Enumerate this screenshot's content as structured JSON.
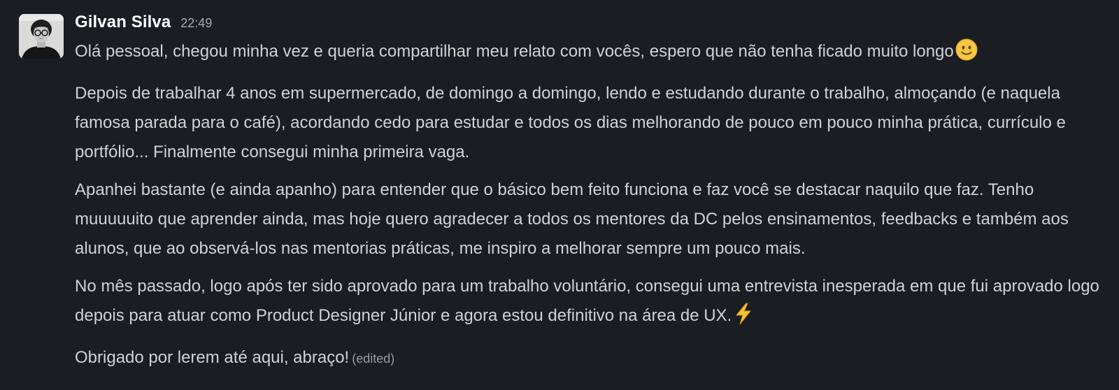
{
  "message": {
    "author": "Gilvan Silva",
    "timestamp": "22:49",
    "paragraphs": [
      "Olá pessoal, chegou minha vez e queria compartilhar meu relato com vocês, espero que não tenha ficado muito longo",
      "Depois de trabalhar 4 anos em supermercado, de domingo a domingo, lendo e estudando durante o trabalho, almoçando (e naquela famosa parada para o café), acordando cedo para estudar e todos os dias melhorando de pouco em pouco minha prática, currículo e portfólio... Finalmente consegui minha primeira vaga.",
      "Apanhei bastante (e ainda apanho) para entender que o básico bem feito funciona e faz você se destacar naquilo que faz. Tenho muuuuuito que aprender ainda, mas hoje quero agradecer a todos os mentores da DC pelos ensinamentos, feedbacks e também aos alunos, que ao observá-los nas mentorias práticas, me inspiro a melhorar sempre um pouco mais.",
      "No mês passado, logo após ter sido aprovado para um trabalho voluntário, consegui uma entrevista inesperada em que fui aprovado logo depois para atuar como Product Designer Júnior e agora estou definitivo na área de UX.",
      "Obrigado por lerem até aqui, abraço!"
    ],
    "edited_label": "(edited)",
    "emojis": {
      "first_paragraph": "slightly-smiling-face-icon",
      "fourth_paragraph": "high-voltage-icon"
    }
  },
  "colors": {
    "background": "#1a1d21",
    "author": "#ffffff",
    "text": "#d1d2d3",
    "muted": "#ababad"
  }
}
